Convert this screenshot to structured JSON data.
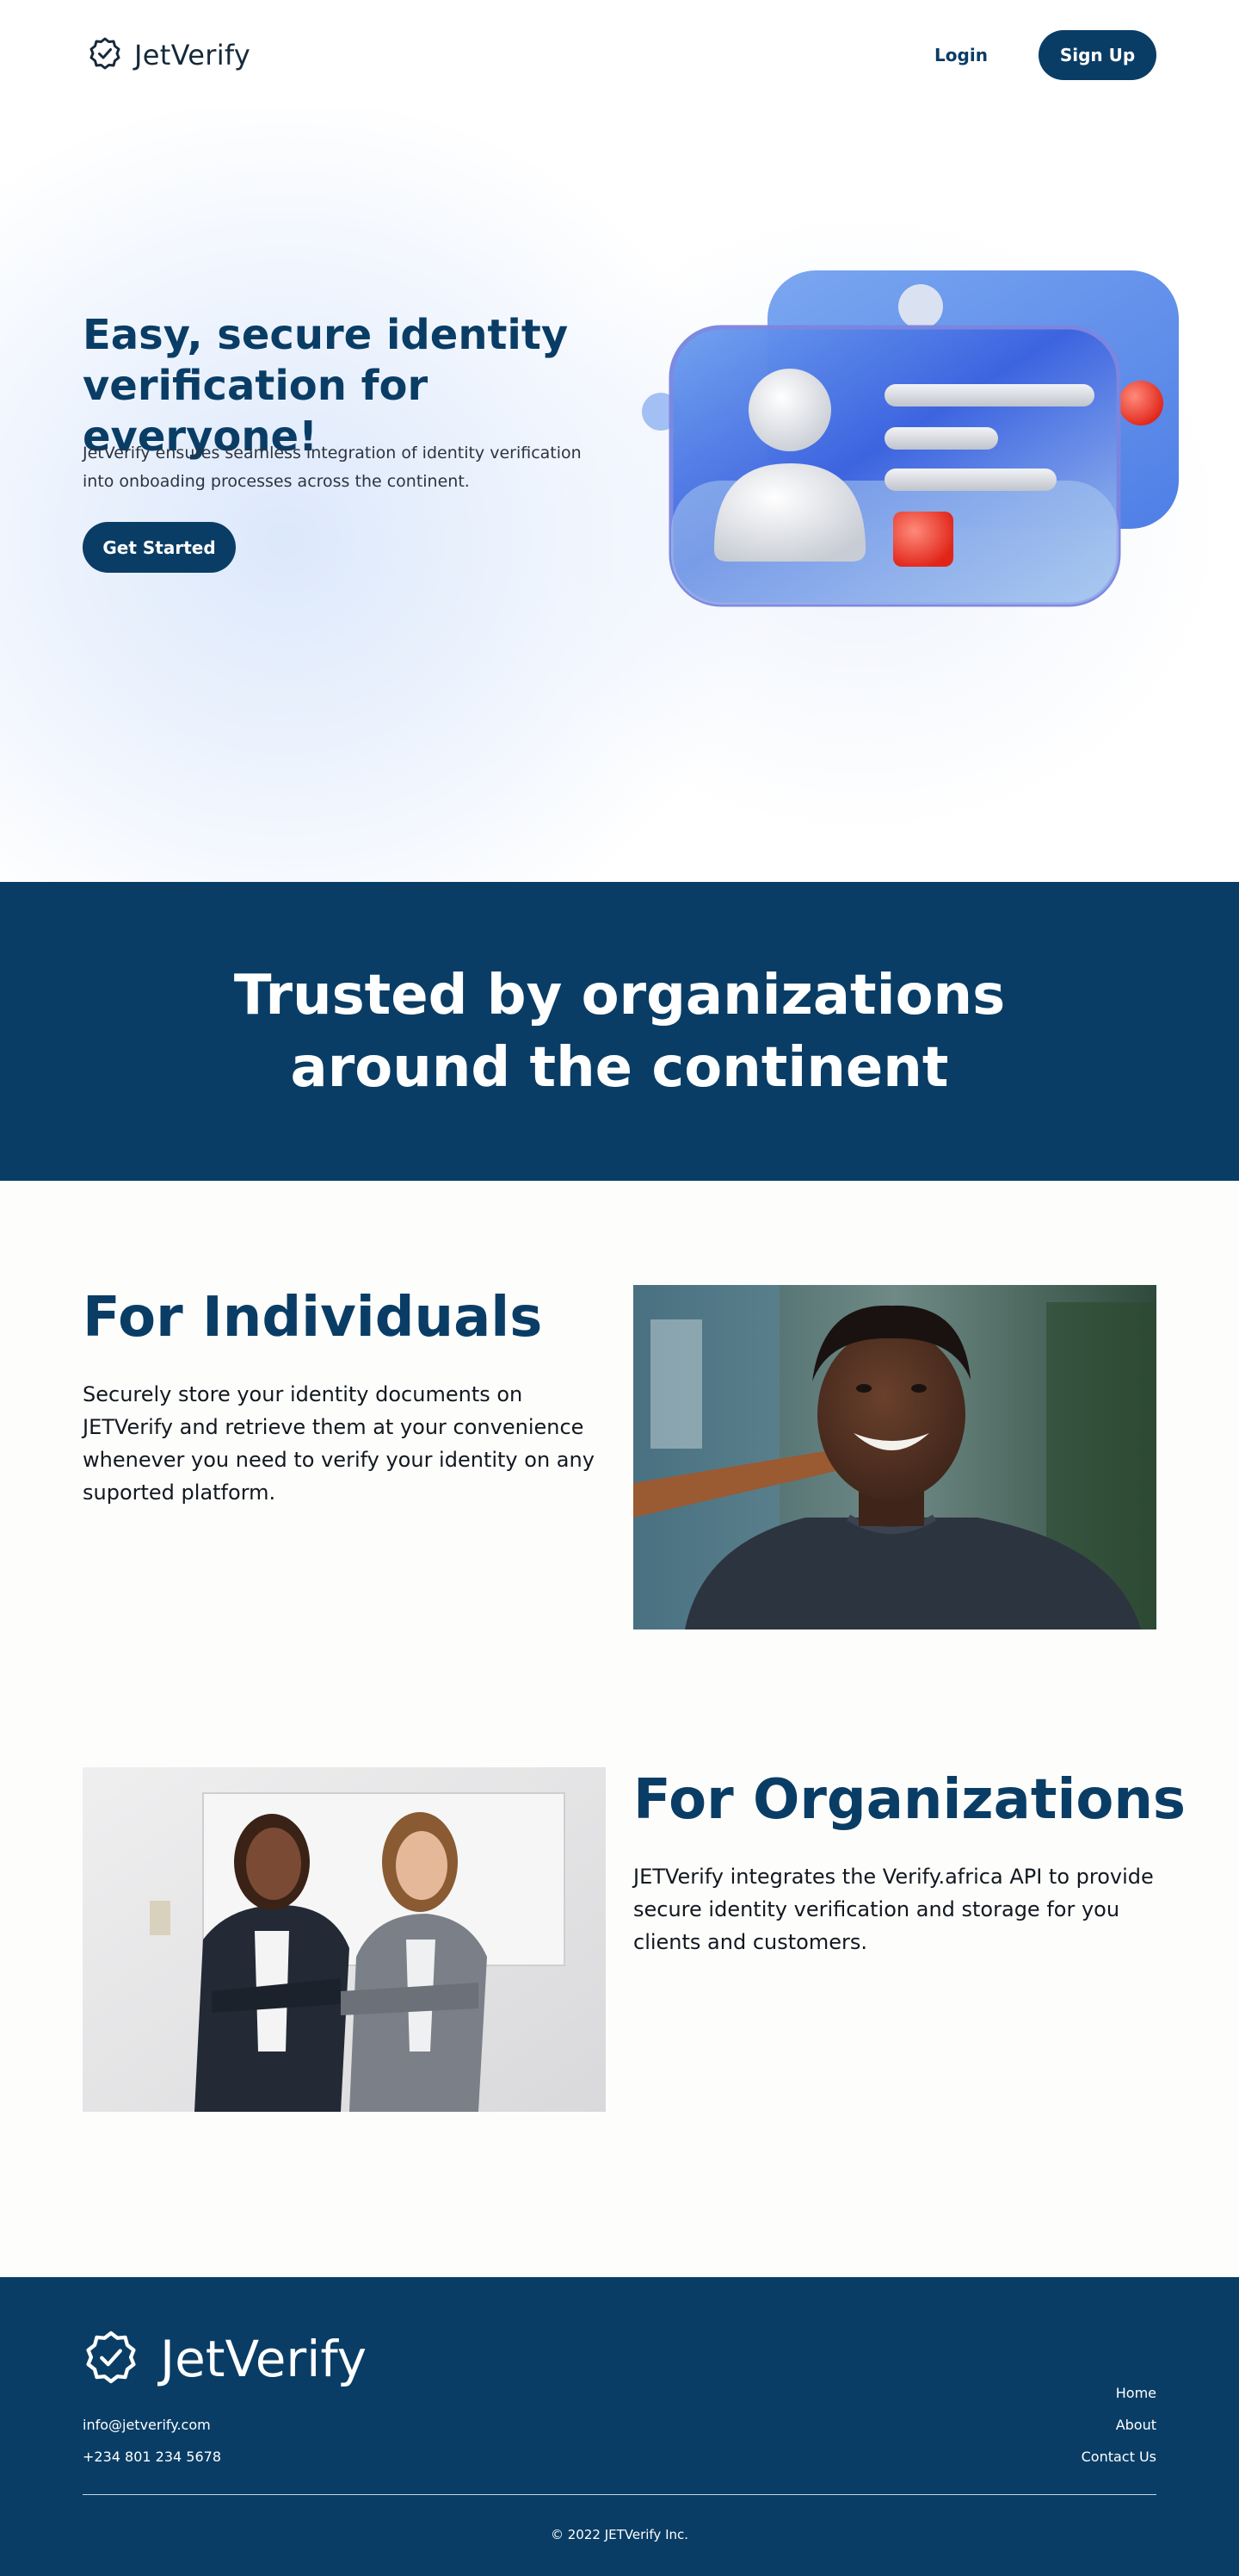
{
  "header": {
    "brand": "JetVerify",
    "login_label": "Login",
    "signup_label": "Sign Up"
  },
  "hero": {
    "title": "Easy, secure identity verification for everyone!",
    "subtitle": "JetVerify ensures seamless integration of identity verification into onboading processes across the continent.",
    "cta_label": "Get Started",
    "illustration_icon": "id-card-illustration"
  },
  "trusted": {
    "title": "Trusted by organizations around the continent"
  },
  "individuals": {
    "title": "For Individuals",
    "body": "Securely store your identity documents on JETVerify and retrieve them at your convenience whenever you need to verify your identity on any suported platform.",
    "photo_icon": "smiling-man-photo"
  },
  "organizations": {
    "title": "For Organizations",
    "body": "JETVerify integrates the Verify.africa API to provide secure identity verification and storage for you clients and customers.",
    "photo_icon": "two-businesswomen-photo"
  },
  "footer": {
    "brand": "JetVerify",
    "email": "info@jetverify.com",
    "phone": "+234 801 234 5678",
    "links": [
      "Home",
      "About",
      "Contact Us"
    ],
    "copyright_symbol": "©",
    "copyright": "2022 JETVerify Inc."
  },
  "colors": {
    "primary": "#0a3d66",
    "band": "#093d65",
    "background": "#fdfdfb"
  }
}
